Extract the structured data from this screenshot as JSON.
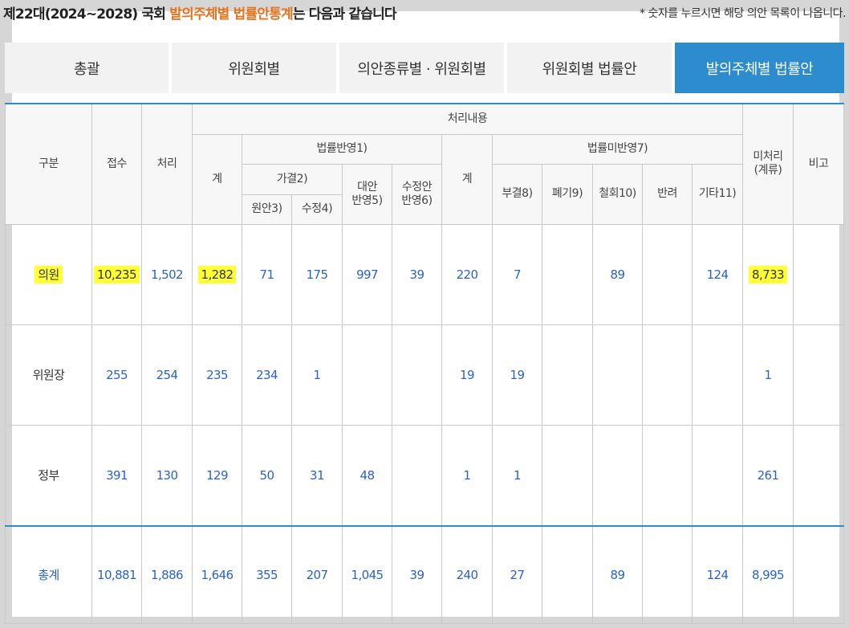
{
  "header": {
    "title_prefix": "제22대(2024~2028) 국회 ",
    "title_highlight": "발의주체별 법률안통계",
    "title_suffix": "는 다음과 같습니다",
    "note": "* 숫자를 누르시면 해당 의안 목록이 나옵니다."
  },
  "tabs": [
    {
      "label": "총괄",
      "active": false
    },
    {
      "label": "위원회별",
      "active": false
    },
    {
      "label": "의안종류별 · 위원회별",
      "active": false
    },
    {
      "label": "위원회별 법률안",
      "active": false
    },
    {
      "label": "발의주체별 법률안",
      "active": true
    }
  ],
  "table": {
    "headers": {
      "category": "구분",
      "received": "접수",
      "processed": "처리",
      "processing_content": "처리내용",
      "unprocessed": "미처리\n(계류)",
      "remarks": "비고",
      "reflected_group": "법률반영1)",
      "reflected_total": "계",
      "passed_group": "가결2)",
      "original": "원안3)",
      "amended": "수정4)",
      "alternative": "대안\n반영5)",
      "amendment_reflected": "수정안\n반영6)",
      "not_reflected_group": "법률미반영7)",
      "not_reflected_total": "계",
      "rejected": "부결8)",
      "discarded": "폐기9)",
      "withdrawn": "철회10)",
      "returned": "반려",
      "other": "기타11)"
    },
    "rows": [
      {
        "category": "의원",
        "received": "10,235",
        "processed": "1,502",
        "reflected_total": "1,282",
        "original": "71",
        "amended": "175",
        "alternative": "997",
        "amendment_reflected": "39",
        "not_reflected_total": "220",
        "rejected": "7",
        "discarded": "",
        "withdrawn": "89",
        "returned": "",
        "other": "124",
        "unprocessed": "8,733",
        "remarks": ""
      },
      {
        "category": "위원장",
        "received": "255",
        "processed": "254",
        "reflected_total": "235",
        "original": "234",
        "amended": "1",
        "alternative": "",
        "amendment_reflected": "",
        "not_reflected_total": "19",
        "rejected": "19",
        "discarded": "",
        "withdrawn": "",
        "returned": "",
        "other": "",
        "unprocessed": "1",
        "remarks": ""
      },
      {
        "category": "정부",
        "received": "391",
        "processed": "130",
        "reflected_total": "129",
        "original": "50",
        "amended": "31",
        "alternative": "48",
        "amendment_reflected": "",
        "not_reflected_total": "1",
        "rejected": "1",
        "discarded": "",
        "withdrawn": "",
        "returned": "",
        "other": "",
        "unprocessed": "261",
        "remarks": ""
      }
    ],
    "total": {
      "category": "총계",
      "received": "10,881",
      "processed": "1,886",
      "reflected_total": "1,646",
      "original": "355",
      "amended": "207",
      "alternative": "1,045",
      "amendment_reflected": "39",
      "not_reflected_total": "240",
      "rejected": "27",
      "discarded": "",
      "withdrawn": "89",
      "returned": "",
      "other": "124",
      "unprocessed": "8,995",
      "remarks": ""
    }
  },
  "colors": {
    "accent": "#2d8ccd",
    "highlight_text": "#e8731e",
    "link_number": "#2a62c9",
    "marker": "#ffff33"
  }
}
